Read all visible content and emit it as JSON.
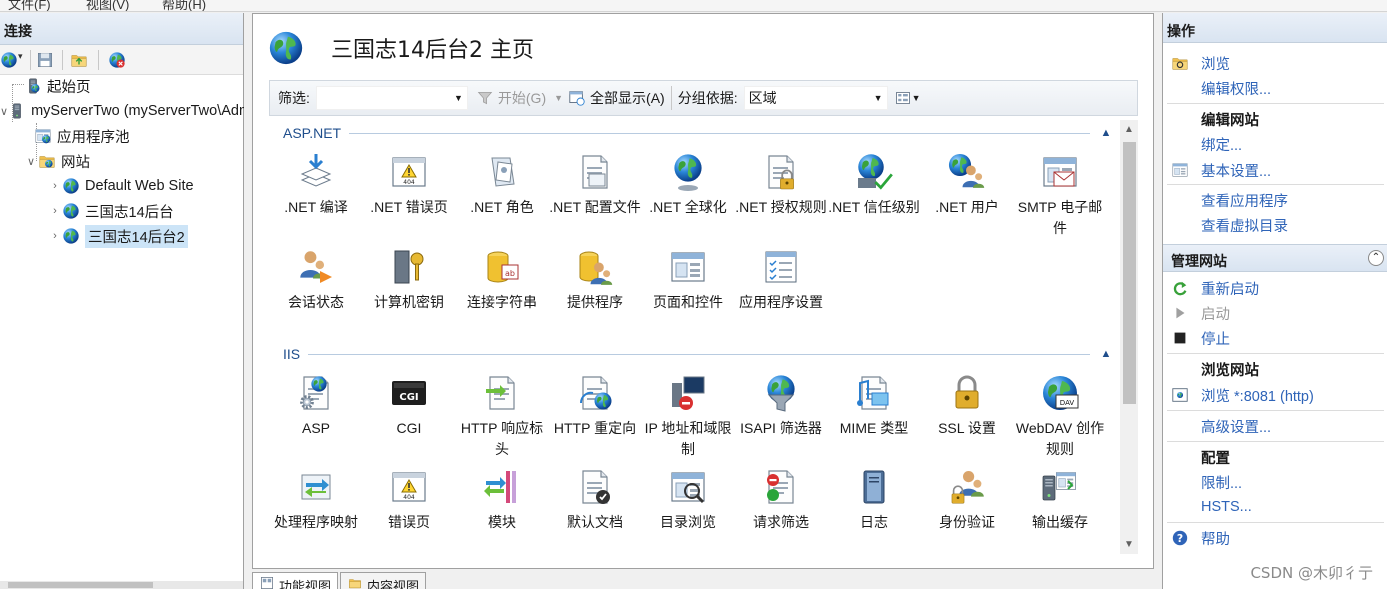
{
  "menubar": {
    "items": [
      "文件(F)",
      "视图(V)",
      "帮助(H)"
    ]
  },
  "connections": {
    "title": "连接",
    "tree": [
      {
        "label": "起始页",
        "icon": "start-page-icon",
        "level": 0
      },
      {
        "label": "myServerTwo (myServerTwo\\Administrator)",
        "icon": "server-icon",
        "level": 0
      },
      {
        "label": "应用程序池",
        "icon": "app-pool-icon",
        "level": 1
      },
      {
        "label": "网站",
        "icon": "sites-folder-icon",
        "level": 1
      },
      {
        "label": "Default Web Site",
        "icon": "website-icon",
        "level": 2
      },
      {
        "label": "三国志14后台",
        "icon": "website-icon",
        "level": 2
      },
      {
        "label": "三国志14后台2",
        "icon": "website-icon",
        "level": 2,
        "selected": true
      }
    ]
  },
  "main": {
    "title": "三国志14后台2 主页",
    "filter": {
      "label": "筛选:",
      "value": "",
      "start_label": "开始(G)",
      "show_all_label": "全部显示(A)",
      "group_by_label": "分组依据:",
      "group_by_value": "区域"
    },
    "groups": [
      {
        "name": "ASP.NET",
        "features": [
          {
            "label": ".NET 编译",
            "icon": "dotnet-compilation-icon"
          },
          {
            "label": ".NET 错误页",
            "icon": "dotnet-error-pages-icon"
          },
          {
            "label": ".NET 角色",
            "icon": "dotnet-roles-icon"
          },
          {
            "label": ".NET 配置文件",
            "icon": "dotnet-profile-icon"
          },
          {
            "label": ".NET 全球化",
            "icon": "dotnet-globalization-icon"
          },
          {
            "label": ".NET 授权规则",
            "icon": "dotnet-authorization-icon"
          },
          {
            "label": ".NET 信任级别",
            "icon": "dotnet-trust-levels-icon"
          },
          {
            "label": ".NET 用户",
            "icon": "dotnet-users-icon"
          },
          {
            "label": "SMTP 电子邮件",
            "icon": "smtp-email-icon"
          },
          {
            "label": "会话状态",
            "icon": "session-state-icon"
          },
          {
            "label": "计算机密钥",
            "icon": "machine-key-icon"
          },
          {
            "label": "连接字符串",
            "icon": "connection-strings-icon"
          },
          {
            "label": "提供程序",
            "icon": "providers-icon"
          },
          {
            "label": "页面和控件",
            "icon": "pages-controls-icon"
          },
          {
            "label": "应用程序设置",
            "icon": "app-settings-icon"
          }
        ]
      },
      {
        "name": "IIS",
        "features": [
          {
            "label": "ASP",
            "icon": "asp-icon"
          },
          {
            "label": "CGI",
            "icon": "cgi-icon"
          },
          {
            "label": "HTTP 响应标头",
            "icon": "http-response-headers-icon"
          },
          {
            "label": "HTTP 重定向",
            "icon": "http-redirect-icon"
          },
          {
            "label": "IP 地址和域限制",
            "icon": "ip-domain-restrictions-icon"
          },
          {
            "label": "ISAPI 筛选器",
            "icon": "isapi-filters-icon"
          },
          {
            "label": "MIME 类型",
            "icon": "mime-types-icon"
          },
          {
            "label": "SSL 设置",
            "icon": "ssl-settings-icon"
          },
          {
            "label": "WebDAV 创作规则",
            "icon": "webdav-icon"
          },
          {
            "label": "处理程序映射",
            "icon": "handler-mappings-icon"
          },
          {
            "label": "错误页",
            "icon": "error-pages-icon"
          },
          {
            "label": "模块",
            "icon": "modules-icon"
          },
          {
            "label": "默认文档",
            "icon": "default-document-icon"
          },
          {
            "label": "目录浏览",
            "icon": "directory-browsing-icon"
          },
          {
            "label": "请求筛选",
            "icon": "request-filtering-icon"
          },
          {
            "label": "日志",
            "icon": "logging-icon"
          },
          {
            "label": "身份验证",
            "icon": "authentication-icon"
          },
          {
            "label": "输出缓存",
            "icon": "output-caching-icon"
          }
        ]
      }
    ],
    "bottom_tabs": [
      "功能视图",
      "内容视图"
    ]
  },
  "actions": {
    "title": "操作",
    "explore": "浏览",
    "edit_permissions": "编辑权限...",
    "edit_site_heading": "编辑网站",
    "bindings": "绑定...",
    "basic_settings": "基本设置...",
    "view_applications": "查看应用程序",
    "view_virtual_dirs": "查看虚拟目录",
    "manage_site_title": "管理网站",
    "restart": "重新启动",
    "start": "启动",
    "stop": "停止",
    "browse_site_heading": "浏览网站",
    "browse_8081": "浏览 *:8081 (http)",
    "advanced_settings": "高级设置...",
    "config_heading": "配置",
    "limits": "限制...",
    "hsts": "HSTS...",
    "help": "帮助"
  },
  "watermark": "CSDN @木卯彳亍",
  "colors": {
    "link": "#2f64b8",
    "header_bg": "#dce6f2",
    "selected": "#cce4f7",
    "group_heading": "#1f4e8c"
  }
}
